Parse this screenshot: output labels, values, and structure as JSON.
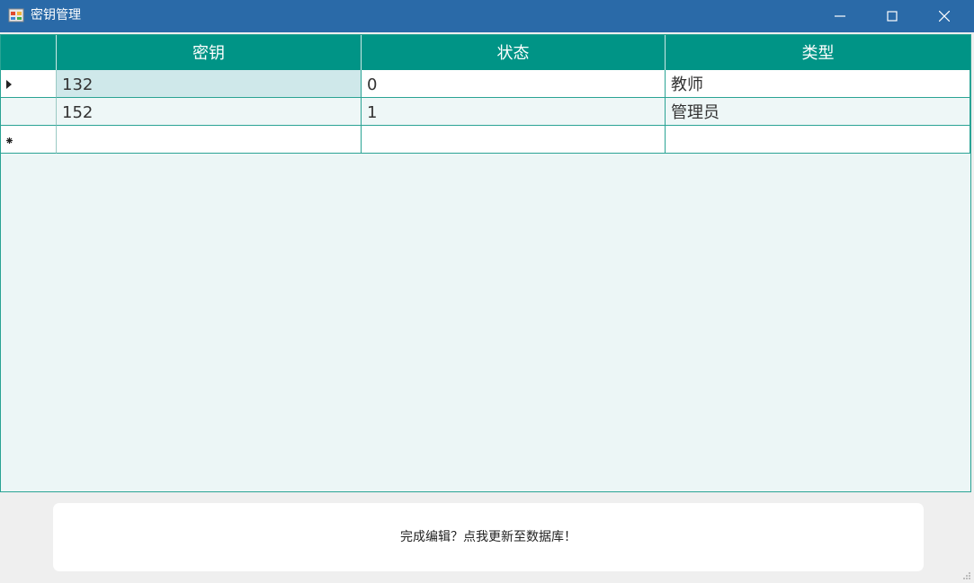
{
  "window": {
    "title": "密钥管理",
    "icons": {
      "app": "app-icon",
      "minimize": "minimize-icon",
      "maximize": "maximize-icon",
      "close": "close-icon"
    }
  },
  "grid": {
    "columns": [
      "密钥",
      "状态",
      "类型"
    ],
    "rows": [
      {
        "key": "132",
        "status": "0",
        "type": "教师",
        "marker": "current-row-arrow-icon"
      },
      {
        "key": "152",
        "status": "1",
        "type": "管理员",
        "marker": ""
      }
    ],
    "new_row_marker": "new-row-asterisk-icon"
  },
  "footer": {
    "update_label": "完成编辑？点我更新至数据库！"
  },
  "colors": {
    "titlebar": "#2a6aa8",
    "header": "#009486",
    "grid_background": "#ecf6f6",
    "selected_cell": "#cfe8ea"
  }
}
